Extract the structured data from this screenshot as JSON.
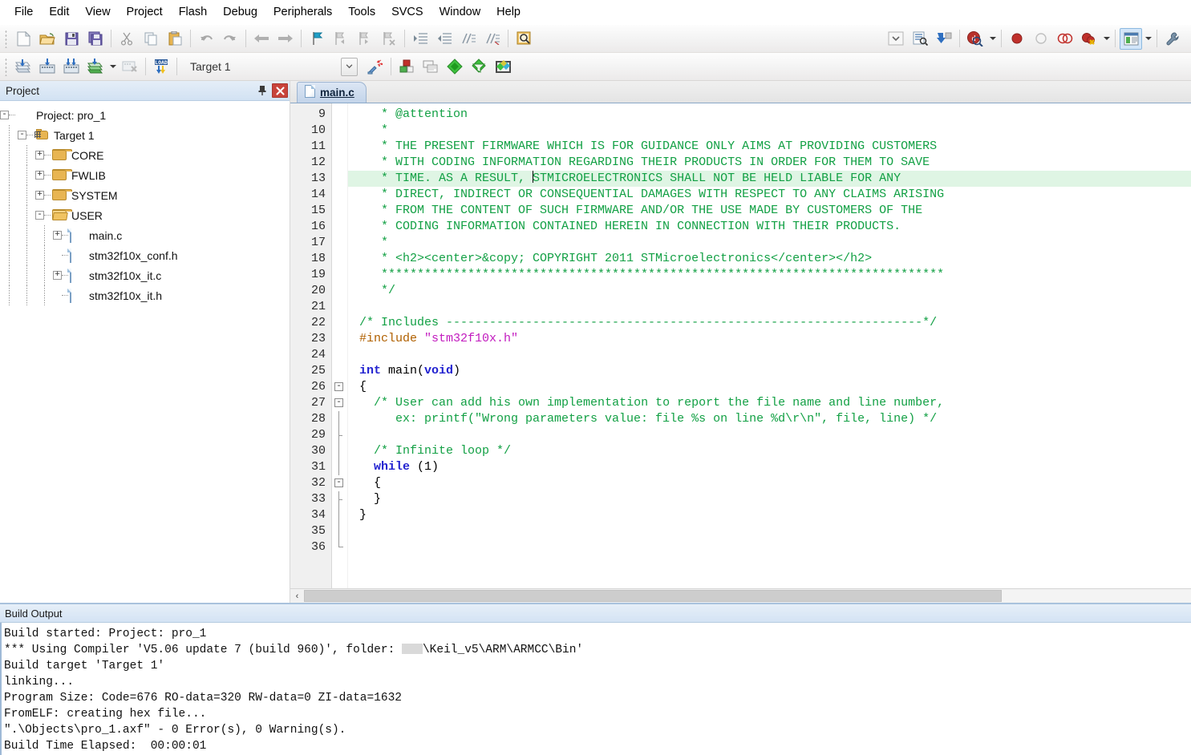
{
  "menubar": {
    "items": [
      {
        "label": "File"
      },
      {
        "label": "Edit"
      },
      {
        "label": "View"
      },
      {
        "label": "Project"
      },
      {
        "label": "Flash"
      },
      {
        "label": "Debug"
      },
      {
        "label": "Peripherals"
      },
      {
        "label": "Tools"
      },
      {
        "label": "SVCS"
      },
      {
        "label": "Window"
      },
      {
        "label": "Help"
      }
    ]
  },
  "toolbar1": {
    "buttons": [
      {
        "name": "new-file-icon",
        "title": "New"
      },
      {
        "name": "open-file-icon",
        "title": "Open"
      },
      {
        "name": "save-icon",
        "title": "Save"
      },
      {
        "name": "save-all-icon",
        "title": "Save All"
      },
      {
        "name": "cut-icon",
        "title": "Cut"
      },
      {
        "name": "copy-icon",
        "title": "Copy"
      },
      {
        "name": "paste-icon",
        "title": "Paste"
      },
      {
        "name": "undo-icon",
        "title": "Undo"
      },
      {
        "name": "redo-icon",
        "title": "Redo"
      },
      {
        "name": "navigate-back-icon",
        "title": "Back"
      },
      {
        "name": "navigate-forward-icon",
        "title": "Forward"
      },
      {
        "name": "toggle-bookmark-icon",
        "title": "Insert/Remove Bookmark"
      },
      {
        "name": "prev-bookmark-icon",
        "title": "Previous Bookmark"
      },
      {
        "name": "next-bookmark-icon",
        "title": "Next Bookmark"
      },
      {
        "name": "clear-bookmarks-icon",
        "title": "Clear All Bookmarks"
      },
      {
        "name": "indent-icon",
        "title": "Indent Selection"
      },
      {
        "name": "outdent-icon",
        "title": "Outdent Selection"
      },
      {
        "name": "comment-selection-icon",
        "title": "Comment Selection"
      },
      {
        "name": "uncomment-selection-icon",
        "title": "Uncomment Selection"
      },
      {
        "name": "find-in-files-icon",
        "title": "Find in Files"
      }
    ],
    "right_buttons": [
      {
        "name": "combo-dropdown-icon",
        "title": "Dropdown"
      },
      {
        "name": "debug-printf-icon",
        "title": "Debug Settings"
      },
      {
        "name": "download-to-flash-icon",
        "title": "Download"
      },
      {
        "name": "start-debug-session-icon",
        "title": "Start/Stop Debug Session"
      },
      {
        "name": "insert-breakpoint-icon",
        "title": "Insert/Remove Breakpoint"
      },
      {
        "name": "disable-breakpoint-icon",
        "title": "Enable/Disable Breakpoint"
      },
      {
        "name": "disable-all-breakpoints-icon",
        "title": "Disable All Breakpoints"
      },
      {
        "name": "kill-all-breakpoints-icon",
        "title": "Kill All Breakpoints"
      },
      {
        "name": "window-layout-icon",
        "title": "Window Layout"
      },
      {
        "name": "configure-icon",
        "title": "Configuration"
      }
    ]
  },
  "toolbar2": {
    "buttons": [
      {
        "name": "translate-file-icon",
        "title": "Translate Current File"
      },
      {
        "name": "build-target-icon",
        "title": "Build"
      },
      {
        "name": "rebuild-all-icon",
        "title": "Rebuild All Target Files"
      },
      {
        "name": "batch-build-icon",
        "title": "Batch Build"
      },
      {
        "name": "stop-build-icon",
        "title": "Stop Build"
      },
      {
        "name": "load-to-flash-icon",
        "title": "Download to Flash"
      }
    ],
    "target_value": "Target 1",
    "right_buttons": [
      {
        "name": "target-options-wizard-icon",
        "title": "Options for Target"
      },
      {
        "name": "manage-project-items-icon",
        "title": "Manage Project Items"
      },
      {
        "name": "manage-multi-project-icon",
        "title": "Manage Multi-Project"
      },
      {
        "name": "configuration-wizard-icon",
        "title": "Configuration Wizard"
      },
      {
        "name": "pack-installer-filter-icon",
        "title": "Filter"
      },
      {
        "name": "pack-installer-icon",
        "title": "Pack Installer"
      }
    ]
  },
  "project_panel": {
    "title": "Project",
    "pin_icon": "pin-icon",
    "close_icon": "close-icon",
    "tree": [
      {
        "label": "Project: pro_1",
        "level": 0,
        "icon": "project-icon",
        "expander": "-"
      },
      {
        "label": "Target 1",
        "level": 1,
        "icon": "target-icon",
        "expander": "-"
      },
      {
        "label": "CORE",
        "level": 2,
        "icon": "folder-icon",
        "expander": "+"
      },
      {
        "label": "FWLIB",
        "level": 2,
        "icon": "folder-icon",
        "expander": "+"
      },
      {
        "label": "SYSTEM",
        "level": 2,
        "icon": "folder-icon",
        "expander": "+"
      },
      {
        "label": "USER",
        "level": 2,
        "icon": "folder-open-icon",
        "expander": "-"
      },
      {
        "label": "main.c",
        "level": 3,
        "icon": "source-file-icon",
        "expander": "+"
      },
      {
        "label": "stm32f10x_conf.h",
        "level": 3,
        "icon": "header-file-icon",
        "expander": ""
      },
      {
        "label": "stm32f10x_it.c",
        "level": 3,
        "icon": "source-file-icon",
        "expander": "+"
      },
      {
        "label": "stm32f10x_it.h",
        "level": 3,
        "icon": "header-file-icon",
        "expander": ""
      }
    ]
  },
  "editor": {
    "tabs": [
      {
        "label": "main.c",
        "icon": "source-file-icon",
        "active": true
      }
    ],
    "first_line_number": 9,
    "highlight_line": 13,
    "lines": [
      {
        "n": 9,
        "fold": "",
        "html": "<span class=\"cm\">   * @attention</span>"
      },
      {
        "n": 10,
        "fold": "",
        "html": "<span class=\"cm\">   *</span>"
      },
      {
        "n": 11,
        "fold": "",
        "html": "<span class=\"cm\">   * THE PRESENT FIRMWARE WHICH IS FOR GUIDANCE ONLY AIMS AT PROVIDING CUSTOMERS</span>"
      },
      {
        "n": 12,
        "fold": "",
        "html": "<span class=\"cm\">   * WITH CODING INFORMATION REGARDING THEIR PRODUCTS IN ORDER FOR THEM TO SAVE</span>"
      },
      {
        "n": 13,
        "fold": "",
        "html": "<span class=\"cm\">   * TIME. AS A RESULT, </span><span class=\"caret-bar\"></span><span class=\"cm\">STMICROELECTRONICS SHALL NOT BE HELD LIABLE FOR ANY</span>"
      },
      {
        "n": 14,
        "fold": "",
        "html": "<span class=\"cm\">   * DIRECT, INDIRECT OR CONSEQUENTIAL DAMAGES WITH RESPECT TO ANY CLAIMS ARISING</span>"
      },
      {
        "n": 15,
        "fold": "",
        "html": "<span class=\"cm\">   * FROM THE CONTENT OF SUCH FIRMWARE AND/OR THE USE MADE BY CUSTOMERS OF THE</span>"
      },
      {
        "n": 16,
        "fold": "",
        "html": "<span class=\"cm\">   * CODING INFORMATION CONTAINED HEREIN IN CONNECTION WITH THEIR PRODUCTS.</span>"
      },
      {
        "n": 17,
        "fold": "",
        "html": "<span class=\"cm\">   *</span>"
      },
      {
        "n": 18,
        "fold": "",
        "html": "<span class=\"cm\">   * &lt;h2&gt;&lt;center&gt;&amp;copy; COPYRIGHT 2011 STMicroelectronics&lt;/center&gt;&lt;/h2&gt;</span>"
      },
      {
        "n": 19,
        "fold": "",
        "html": "<span class=\"cm\">   ******************************************************************************</span>"
      },
      {
        "n": 20,
        "fold": "",
        "html": "<span class=\"cm\">   */</span>"
      },
      {
        "n": 21,
        "fold": "",
        "html": ""
      },
      {
        "n": 22,
        "fold": "",
        "html": "<span class=\"cm\">/* Includes ------------------------------------------------------------------*/</span>"
      },
      {
        "n": 23,
        "fold": "",
        "html": "<span class=\"pp\">#include</span> <span class=\"str\">\"stm32f10x.h\"</span>"
      },
      {
        "n": 24,
        "fold": "",
        "html": ""
      },
      {
        "n": 25,
        "fold": "",
        "html": "<span class=\"kw\">int</span> main(<span class=\"kw\">void</span>)"
      },
      {
        "n": 26,
        "fold": "minus",
        "html": "{"
      },
      {
        "n": 27,
        "fold": "minus",
        "html": "  <span class=\"cm\">/* User can add his own implementation to report the file name and line number,</span>"
      },
      {
        "n": 28,
        "fold": "stem",
        "html": "<span class=\"cm\">     ex: printf(\"Wrong parameters value: file %s on line %d\\r\\n\", file, line) */</span>"
      },
      {
        "n": 29,
        "fold": "tick",
        "html": ""
      },
      {
        "n": 30,
        "fold": "stem",
        "html": "  <span class=\"cm\">/* Infinite loop */</span>"
      },
      {
        "n": 31,
        "fold": "stem",
        "html": "  <span class=\"kw\">while</span> (1)"
      },
      {
        "n": 32,
        "fold": "minus2",
        "html": "  {"
      },
      {
        "n": 33,
        "fold": "tick",
        "html": "  }"
      },
      {
        "n": 34,
        "fold": "stem",
        "html": "}"
      },
      {
        "n": 35,
        "fold": "stem",
        "html": ""
      },
      {
        "n": 36,
        "fold": "end",
        "html": ""
      }
    ],
    "scrollbar": {
      "left_arrow": "‹"
    }
  },
  "build_output": {
    "title": "Build Output",
    "lines": [
      {
        "text": "Build started: Project: pro_1"
      },
      {
        "text": "*** Using Compiler 'V5.06 update 7 (build 960)', folder: ",
        "redacted": true,
        "suffix": "\\Keil_v5\\ARM\\ARMCC\\Bin'"
      },
      {
        "text": "Build target 'Target 1'"
      },
      {
        "text": "linking..."
      },
      {
        "text": "Program Size: Code=676 RO-data=320 RW-data=0 ZI-data=1632"
      },
      {
        "text": "FromELF: creating hex file..."
      },
      {
        "text": "\".\\Objects\\pro_1.axf\" - 0 Error(s), 0 Warning(s)."
      },
      {
        "text": "Build Time Elapsed:  00:00:01"
      }
    ]
  },
  "colors": {
    "comment_green": "#12a044",
    "keyword_blue": "#2222d0",
    "string_magenta": "#c21bbf",
    "preproc_orange": "#b06000",
    "highlight_line": "#dff5e4",
    "panel_header": "#d4e3f4",
    "close_red": "#c8433b"
  }
}
